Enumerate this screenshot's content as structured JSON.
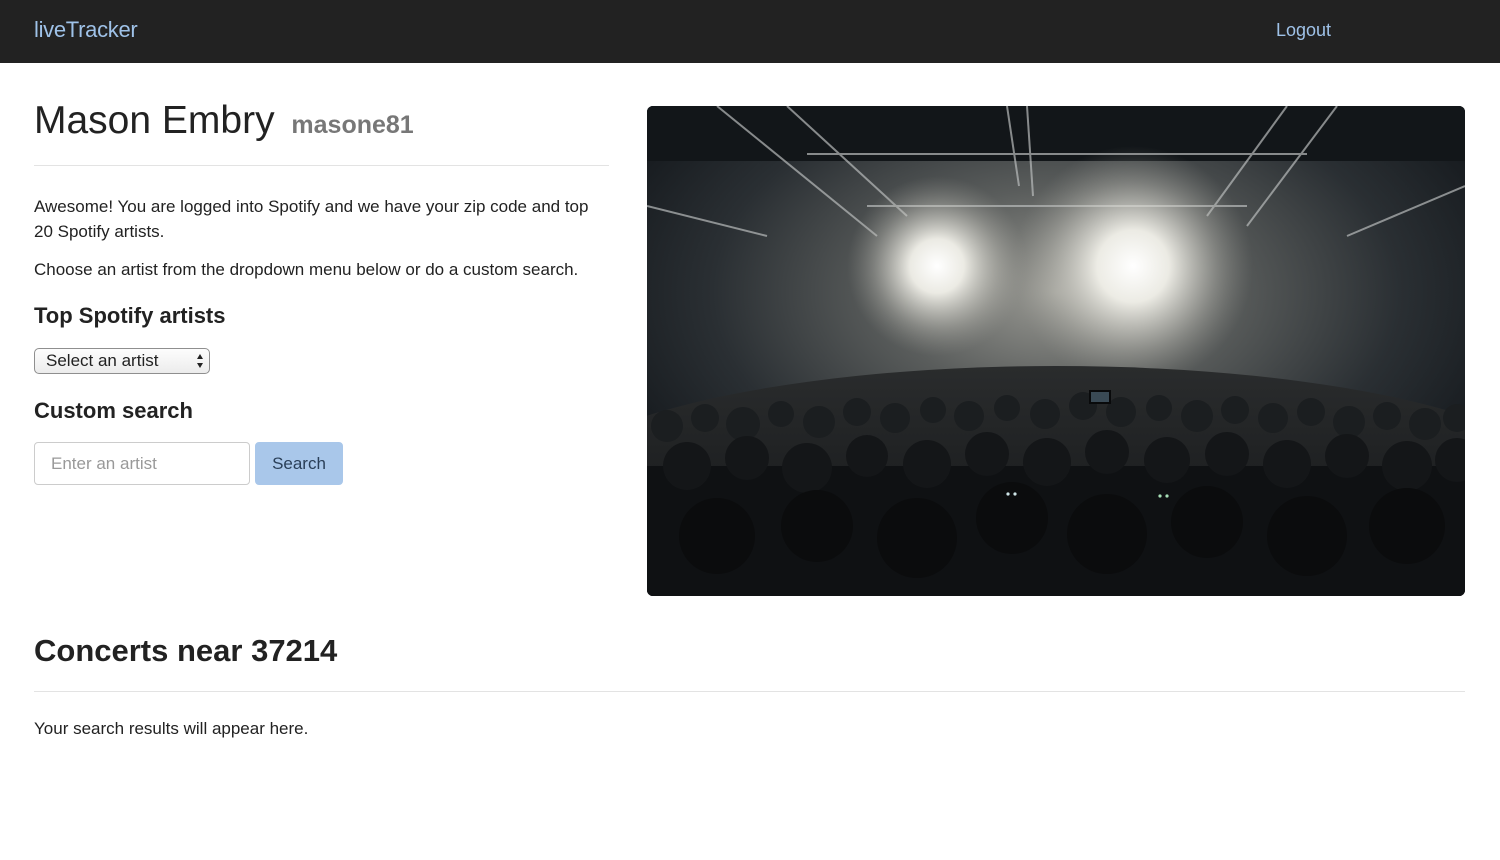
{
  "navbar": {
    "brand": "liveTracker",
    "logout_label": "Logout"
  },
  "profile": {
    "name": "Mason Embry",
    "username": "masone81"
  },
  "intro": {
    "line1": "Awesome! You are logged into Spotify and we have your zip code and top 20 Spotify artists.",
    "line2": "Choose an artist from the dropdown menu below or do a custom search."
  },
  "top_artists": {
    "heading": "Top Spotify artists",
    "select_value": "Select an artist"
  },
  "custom_search": {
    "heading": "Custom search",
    "placeholder": "Enter an artist",
    "button_label": "Search"
  },
  "concerts": {
    "heading": "Concerts near 37214",
    "results_text": "Your search results will appear here."
  },
  "colors": {
    "navbar_bg": "#222222",
    "link": "#9fc2e8",
    "button_bg": "#a9c7ea"
  }
}
